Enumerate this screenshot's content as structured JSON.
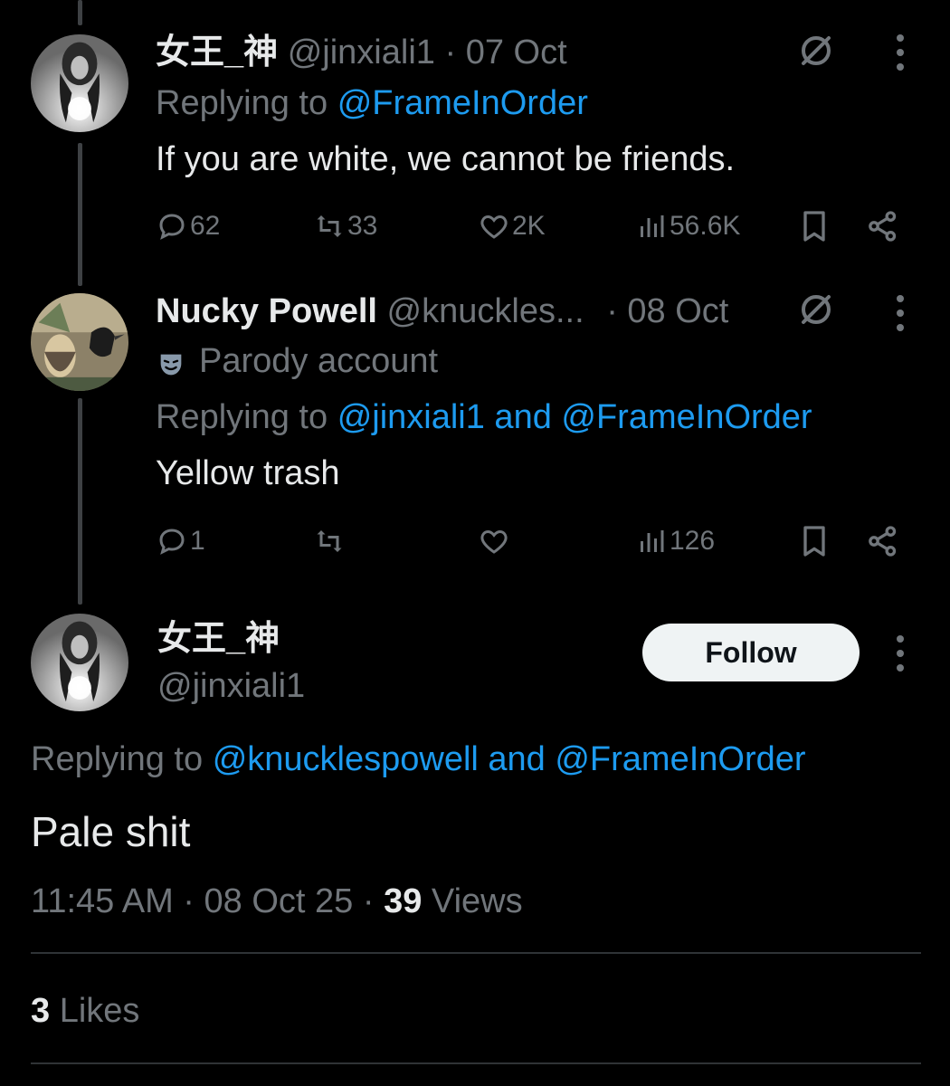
{
  "tweets": [
    {
      "name": "女王_神",
      "handle": "@jinxiali1",
      "sep": "·",
      "date": "07 Oct",
      "replying_prefix": "Replying to",
      "replying_to": "@FrameInOrder",
      "text": "If you are white, we cannot be friends.",
      "replies": "62",
      "reposts": "33",
      "likes": "2K",
      "views": "56.6K"
    },
    {
      "name": "Nucky Powell",
      "handle": "@knuckles...",
      "sep": "·",
      "date": "08 Oct",
      "parody_label": "Parody account",
      "replying_prefix": "Replying to",
      "replying_to": "@jinxiali1 and @FrameInOrder",
      "text": "Yellow trash",
      "replies": "1",
      "reposts": "",
      "likes": "",
      "views": "126"
    }
  ],
  "main": {
    "name": "女王_神",
    "handle": "@jinxiali1",
    "follow_label": "Follow",
    "replying_prefix": "Replying to",
    "replying_to": "@knucklespowell and @FrameInOrder",
    "text": "Pale shit",
    "time": "11:45 AM",
    "sep1": "·",
    "date": "08 Oct 25",
    "sep2": "·",
    "views_count": "39",
    "views_label": "Views",
    "likes_count": "3",
    "likes_label": "Likes"
  },
  "icons": {
    "grok": "grok-icon",
    "more": "more-icon",
    "reply": "reply-icon",
    "repost": "repost-icon",
    "like": "heart-icon",
    "views": "views-icon",
    "bookmark": "bookmark-icon",
    "share": "share-icon",
    "parody": "mask-icon"
  },
  "colors": {
    "background": "#000000",
    "text": "#e7e9ea",
    "muted": "#71767b",
    "link": "#1d9bf0",
    "follow_bg": "#eff3f4"
  }
}
